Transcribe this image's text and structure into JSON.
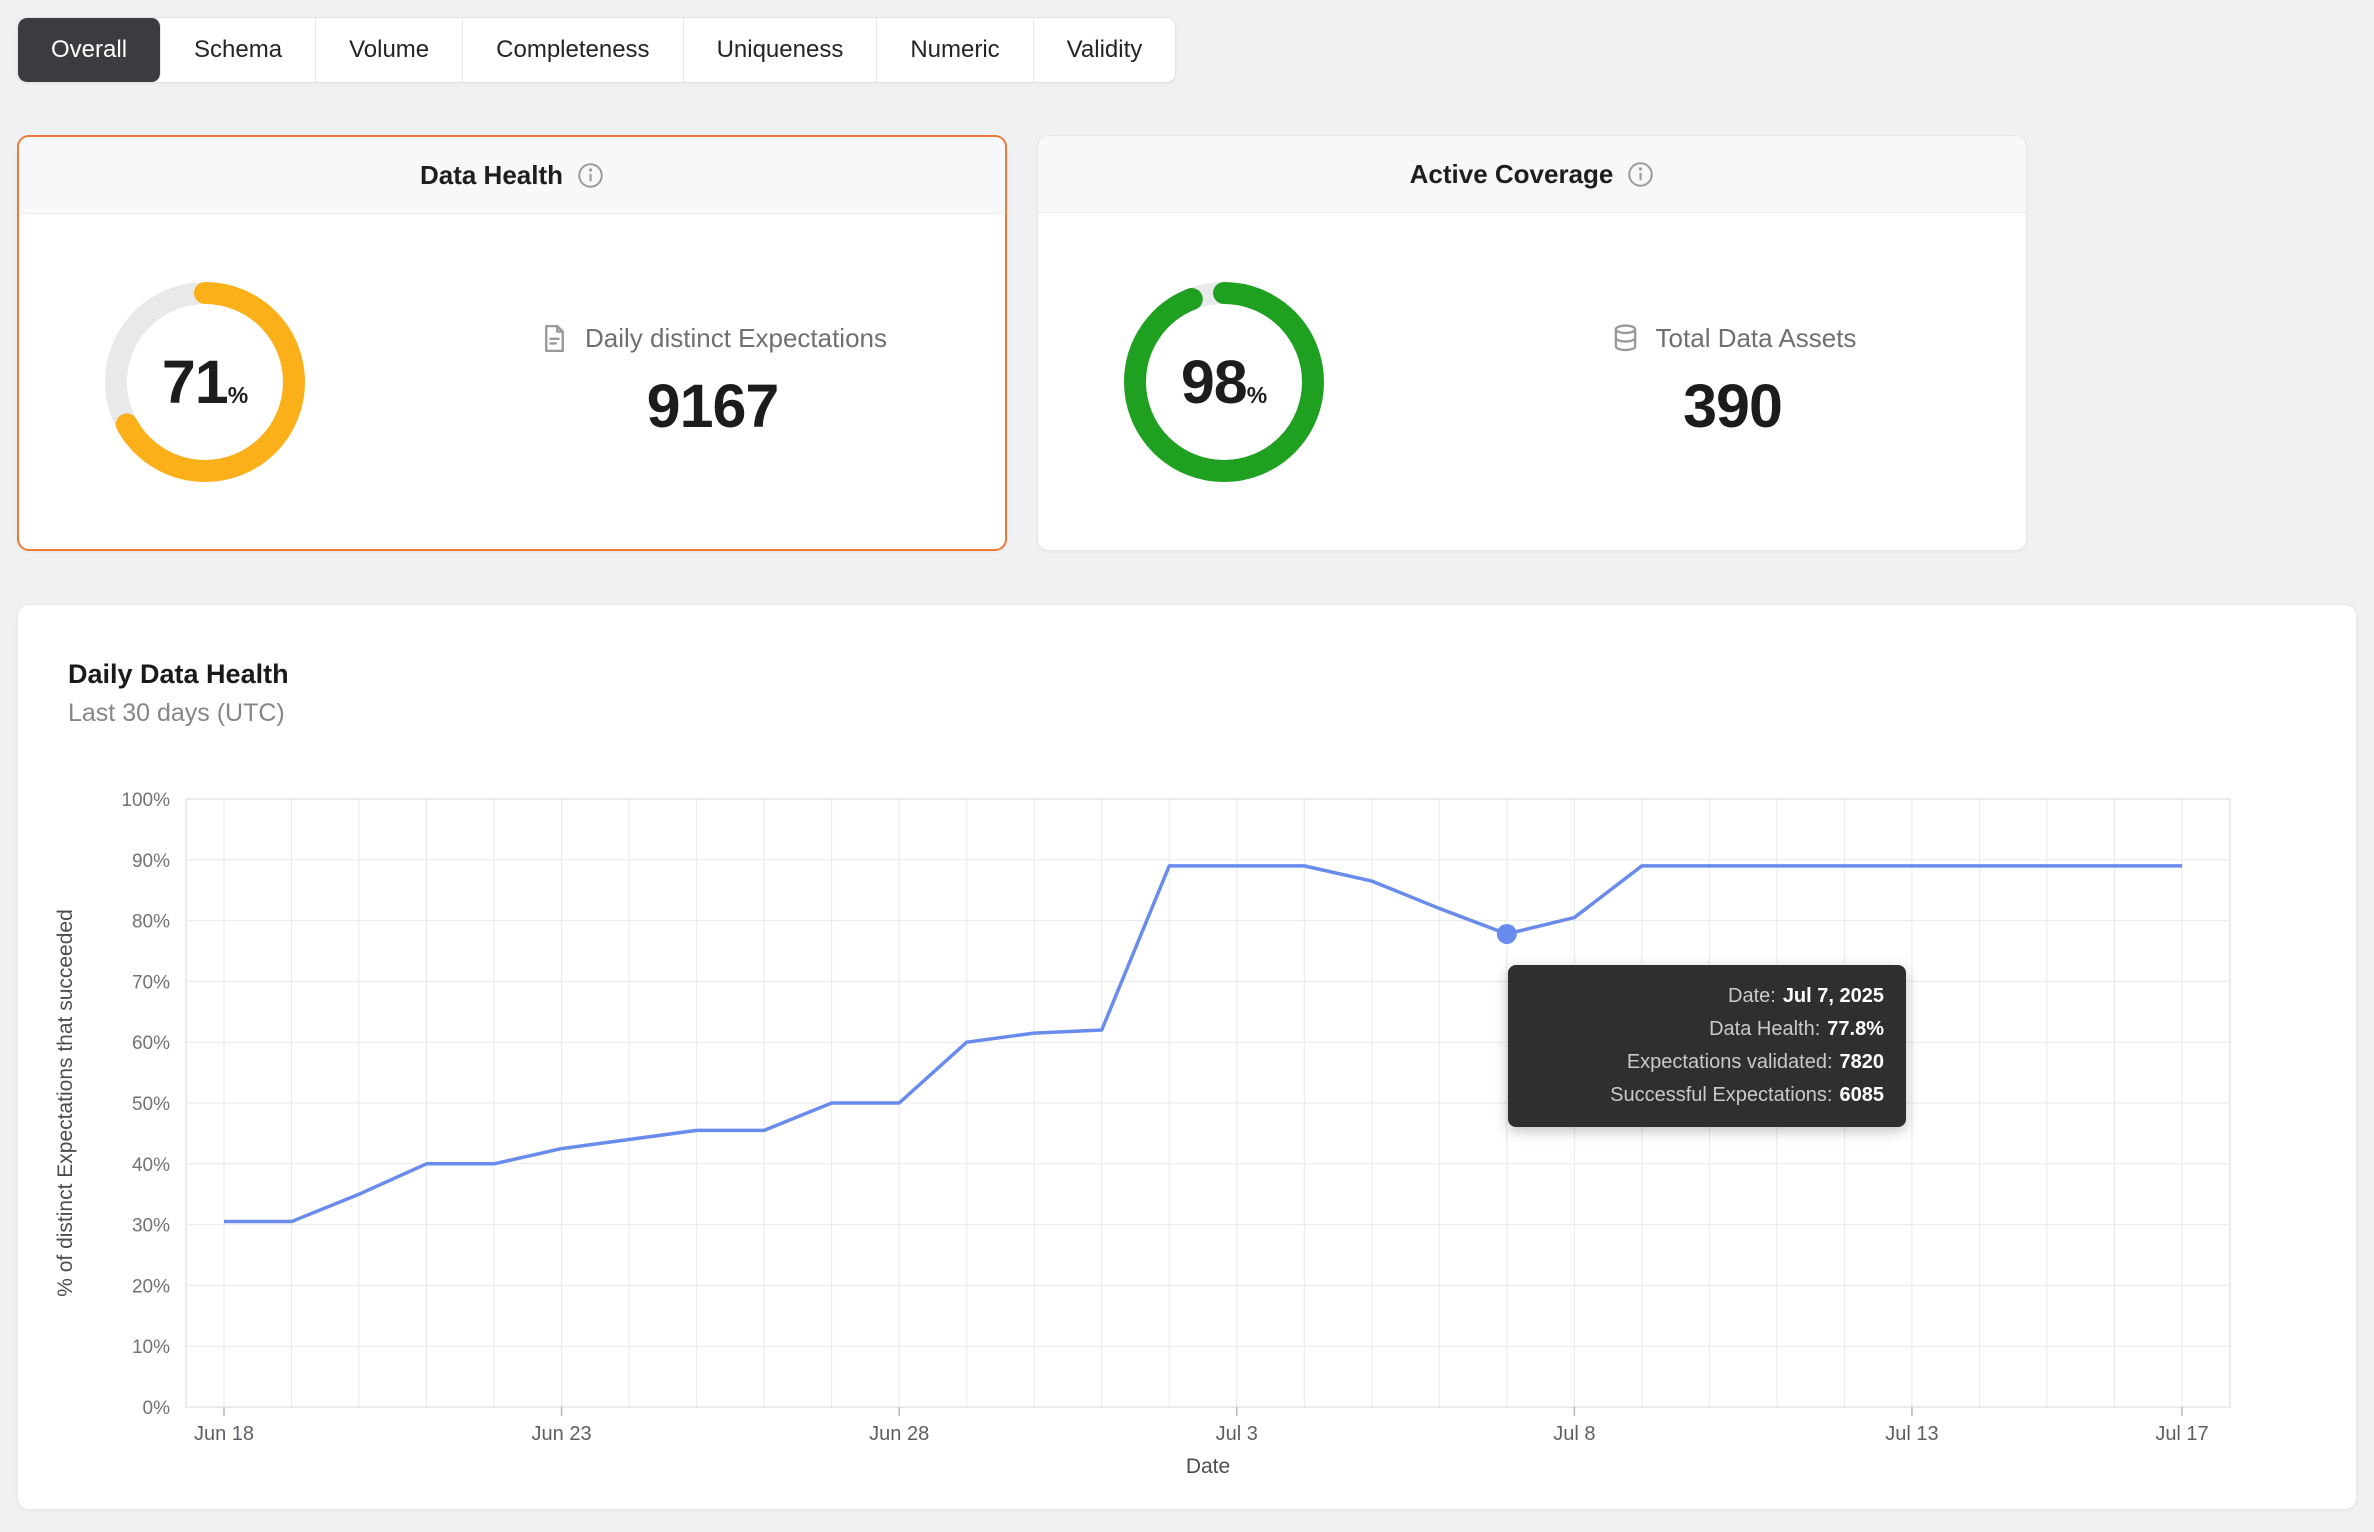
{
  "tabs": [
    {
      "label": "Overall",
      "selected": true
    },
    {
      "label": "Schema",
      "selected": false
    },
    {
      "label": "Volume",
      "selected": false
    },
    {
      "label": "Completeness",
      "selected": false
    },
    {
      "label": "Uniqueness",
      "selected": false
    },
    {
      "label": "Numeric",
      "selected": false
    },
    {
      "label": "Validity",
      "selected": false
    }
  ],
  "cards": {
    "data_health": {
      "title": "Data Health",
      "percent": 71,
      "percent_display": "71",
      "percent_unit": "%",
      "ring_color": "#FBB019",
      "metric_label": "Daily distinct Expectations",
      "metric_value": "9167",
      "selected": true
    },
    "active_coverage": {
      "title": "Active Coverage",
      "percent": 98,
      "percent_display": "98",
      "percent_unit": "%",
      "ring_color": "#1FA020",
      "metric_label": "Total Data Assets",
      "metric_value": "390",
      "selected": false
    }
  },
  "chart_panel": {
    "title": "Daily Data Health",
    "subtitle": "Last 30 days (UTC)"
  },
  "tooltip": {
    "date_label": "Date:",
    "date_value": "Jul 7, 2025",
    "health_label": "Data Health:",
    "health_value": "77.8%",
    "validated_label": "Expectations validated:",
    "validated_value": "7820",
    "successful_label": "Successful Expectations:",
    "successful_value": "6085"
  },
  "chart_data": {
    "type": "line",
    "title": "Daily Data Health",
    "xlabel": "Date",
    "ylabel": "% of distinct Expectations that succeeded",
    "ylim": [
      0,
      100
    ],
    "y_tick_step": 10,
    "grid": true,
    "line_color": "#698CEC",
    "x": [
      "Jun 18",
      "Jun 19",
      "Jun 20",
      "Jun 21",
      "Jun 22",
      "Jun 23",
      "Jun 24",
      "Jun 25",
      "Jun 26",
      "Jun 27",
      "Jun 28",
      "Jun 29",
      "Jun 30",
      "Jul 1",
      "Jul 2",
      "Jul 3",
      "Jul 4",
      "Jul 5",
      "Jul 6",
      "Jul 7",
      "Jul 8",
      "Jul 9",
      "Jul 10",
      "Jul 11",
      "Jul 12",
      "Jul 13",
      "Jul 14",
      "Jul 15",
      "Jul 16",
      "Jul 17"
    ],
    "values": [
      30.5,
      30.5,
      35,
      40,
      40,
      42.5,
      44,
      45.5,
      45.5,
      50,
      50,
      60,
      61.5,
      62,
      89,
      89,
      89,
      86.5,
      82,
      77.8,
      80.5,
      89,
      89,
      89,
      89,
      89,
      89,
      89,
      89,
      89
    ],
    "x_tick_labels": [
      "Jun 18",
      "Jun 23",
      "Jun 28",
      "Jul 3",
      "Jul 8",
      "Jul 13",
      "Jul 17"
    ],
    "highlight": {
      "x": "Jul 7",
      "value": 77.8
    }
  }
}
